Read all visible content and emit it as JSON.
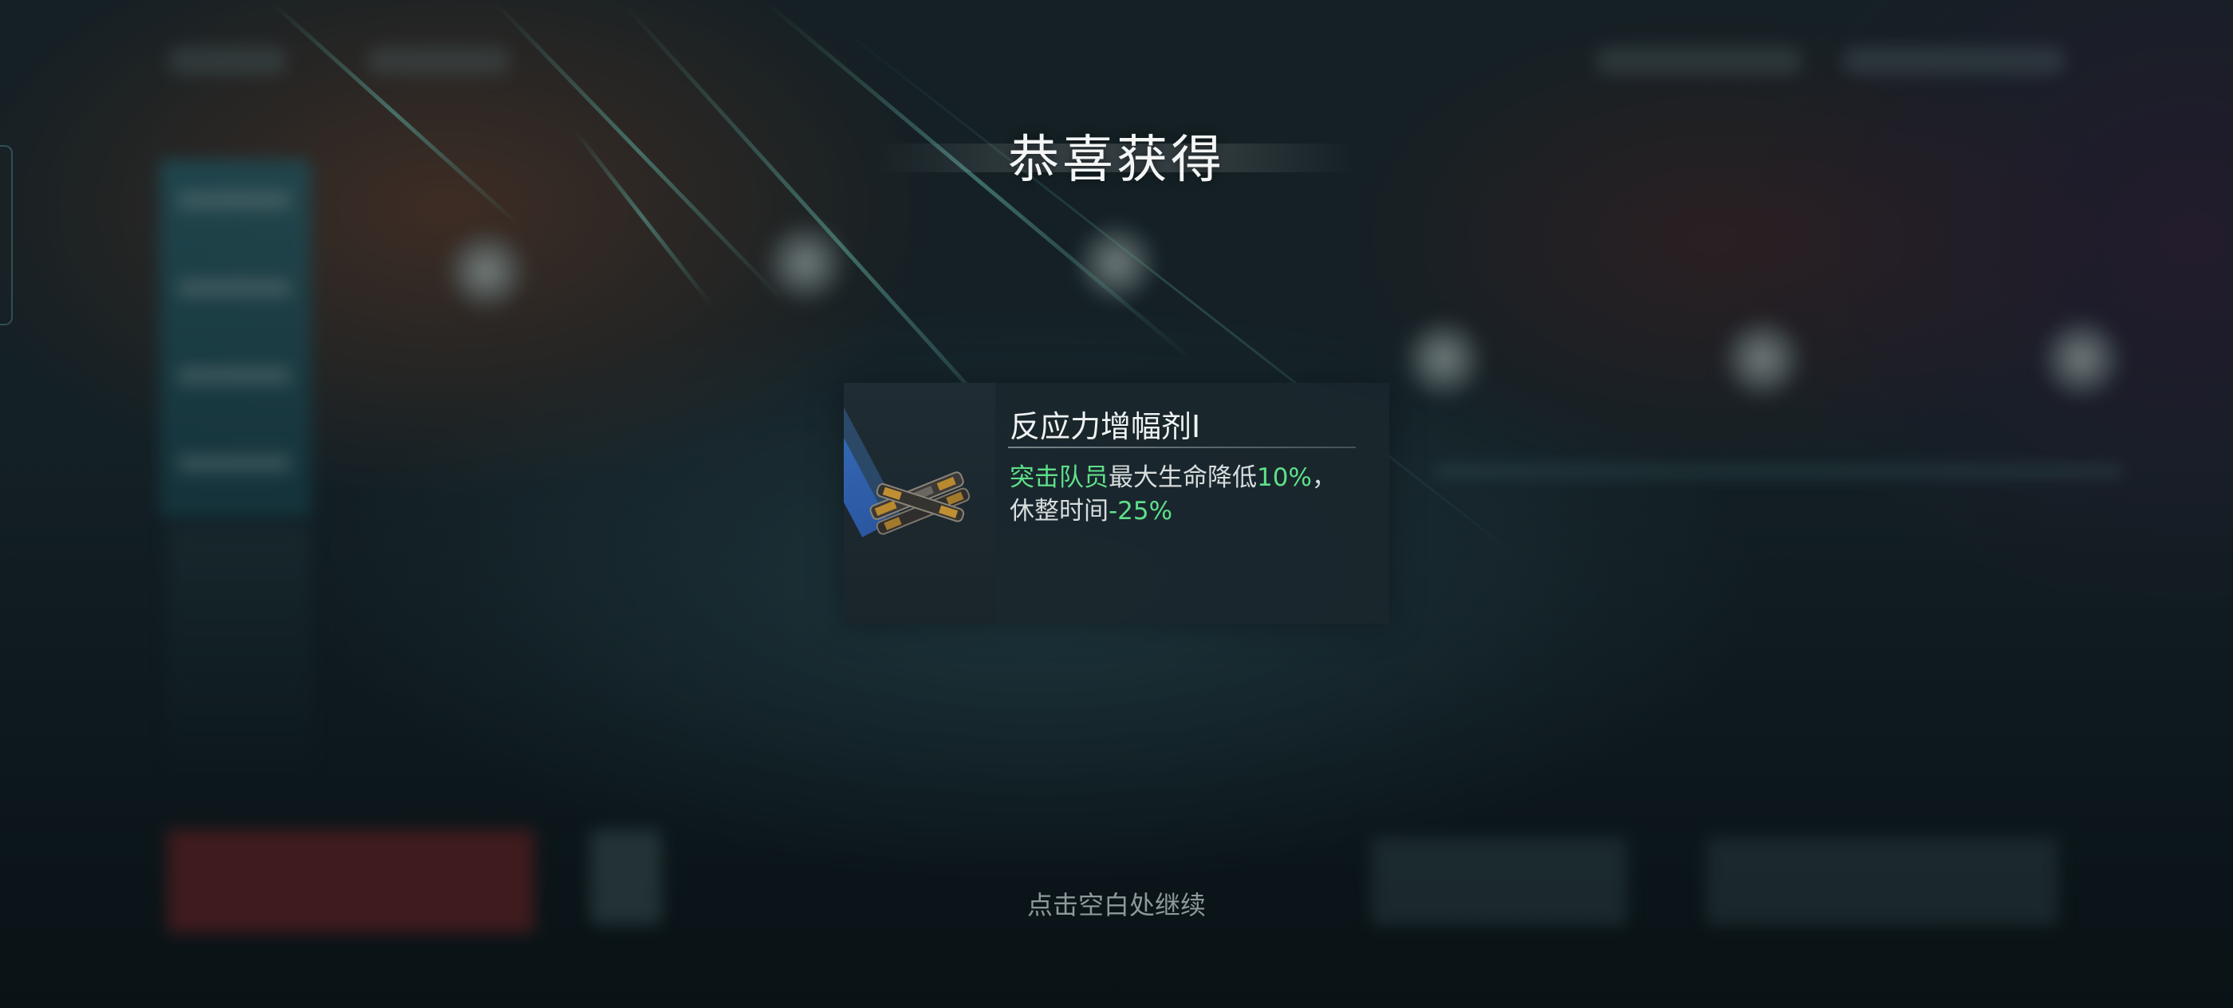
{
  "title": "恭喜获得",
  "reward": {
    "name": "反应力增幅剂I",
    "icon": "stimulant-injector-icon",
    "desc_parts": {
      "p1": "突击队员",
      "p2": "最大生命降低",
      "p3": "10%",
      "p4": "，休整时间",
      "p5": "-25%"
    }
  },
  "continue_hint": "点击空白处继续",
  "colors": {
    "highlight": "#5ee08a",
    "title": "#f4f6f6",
    "card_bg": "#1a262c",
    "accent_blue": "#3f78c8"
  }
}
